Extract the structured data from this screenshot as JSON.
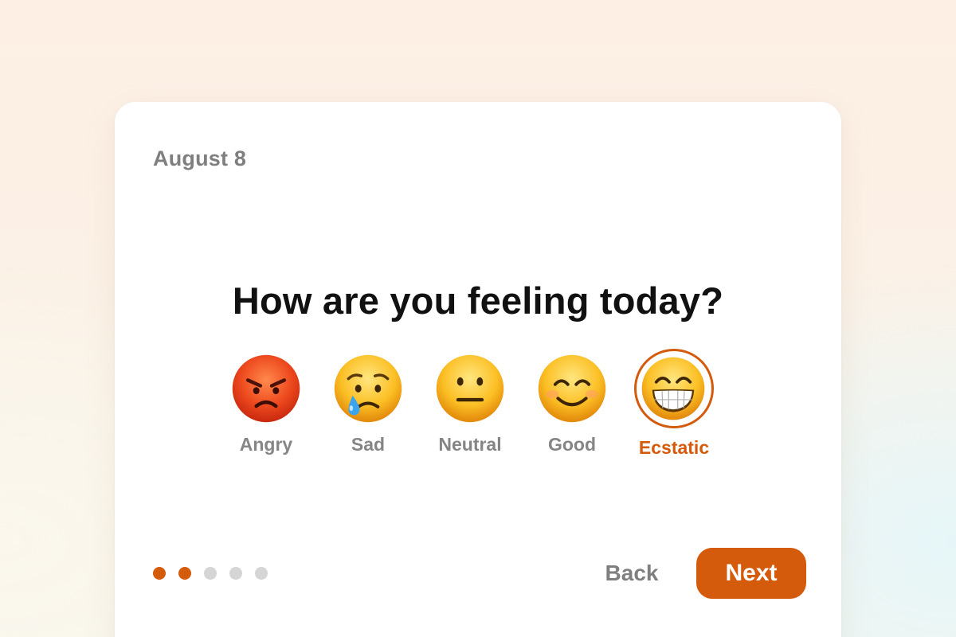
{
  "date": "August 8",
  "question": "How are you feeling today?",
  "moods": [
    {
      "label": "Angry",
      "icon": "angry-face-icon",
      "selected": false
    },
    {
      "label": "Sad",
      "icon": "crying-face-icon",
      "selected": false
    },
    {
      "label": "Neutral",
      "icon": "neutral-face-icon",
      "selected": false
    },
    {
      "label": "Good",
      "icon": "smiling-face-icon",
      "selected": false
    },
    {
      "label": "Ecstatic",
      "icon": "grinning-face-icon",
      "selected": true
    }
  ],
  "progress": {
    "total_steps": 5,
    "current_step": 2
  },
  "buttons": {
    "back_label": "Back",
    "next_label": "Next"
  },
  "colors": {
    "accent": "#d45a0c",
    "muted_text": "#7f7f7f",
    "inactive_dot": "#d5d5d5"
  }
}
